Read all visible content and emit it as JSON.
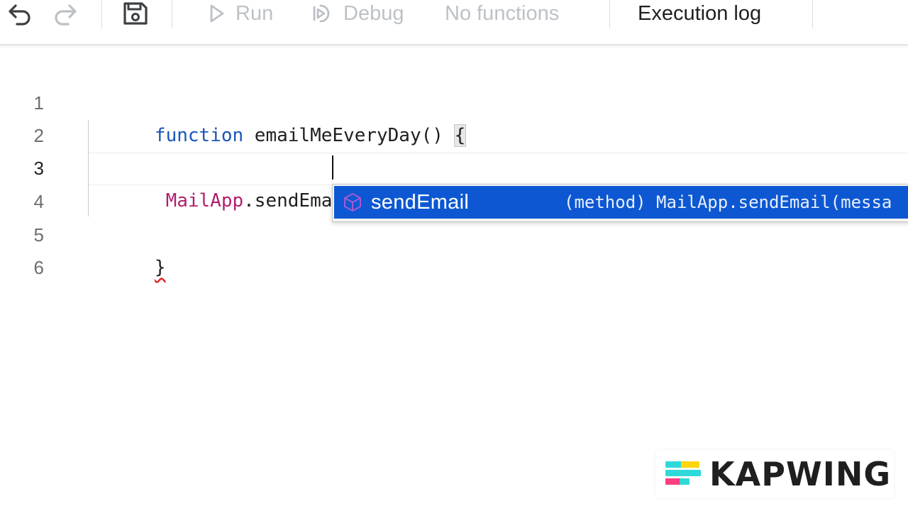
{
  "toolbar": {
    "undo_icon": "undo-icon",
    "redo_icon": "redo-icon",
    "save_icon": "save-icon",
    "run_label": "Run",
    "debug_label": "Debug",
    "function_select": "No functions",
    "execution_log_label": "Execution log"
  },
  "editor": {
    "line_numbers": [
      "1",
      "2",
      "3",
      "4",
      "5",
      "6"
    ],
    "active_line": 3,
    "line1": {
      "keyword": "function",
      "name": " emailMeEveryDay() ",
      "brace": "{"
    },
    "line3": {
      "indent": " ",
      "class_name": "MailApp",
      "member": ".sendEmail"
    },
    "line5": {
      "brace": "}"
    }
  },
  "suggest": {
    "icon": "method-cube-icon",
    "label": "sendEmail",
    "detail": "(method) MailApp.sendEmail(messa"
  },
  "watermark": {
    "text": "KAPWING",
    "logo_colors": [
      "#2fd9d9",
      "#ffd60a",
      "#ff3d7f"
    ]
  },
  "colors": {
    "keyword": "#1a56b8",
    "class": "#b0206e",
    "suggest_highlight": "#0d58d2"
  }
}
